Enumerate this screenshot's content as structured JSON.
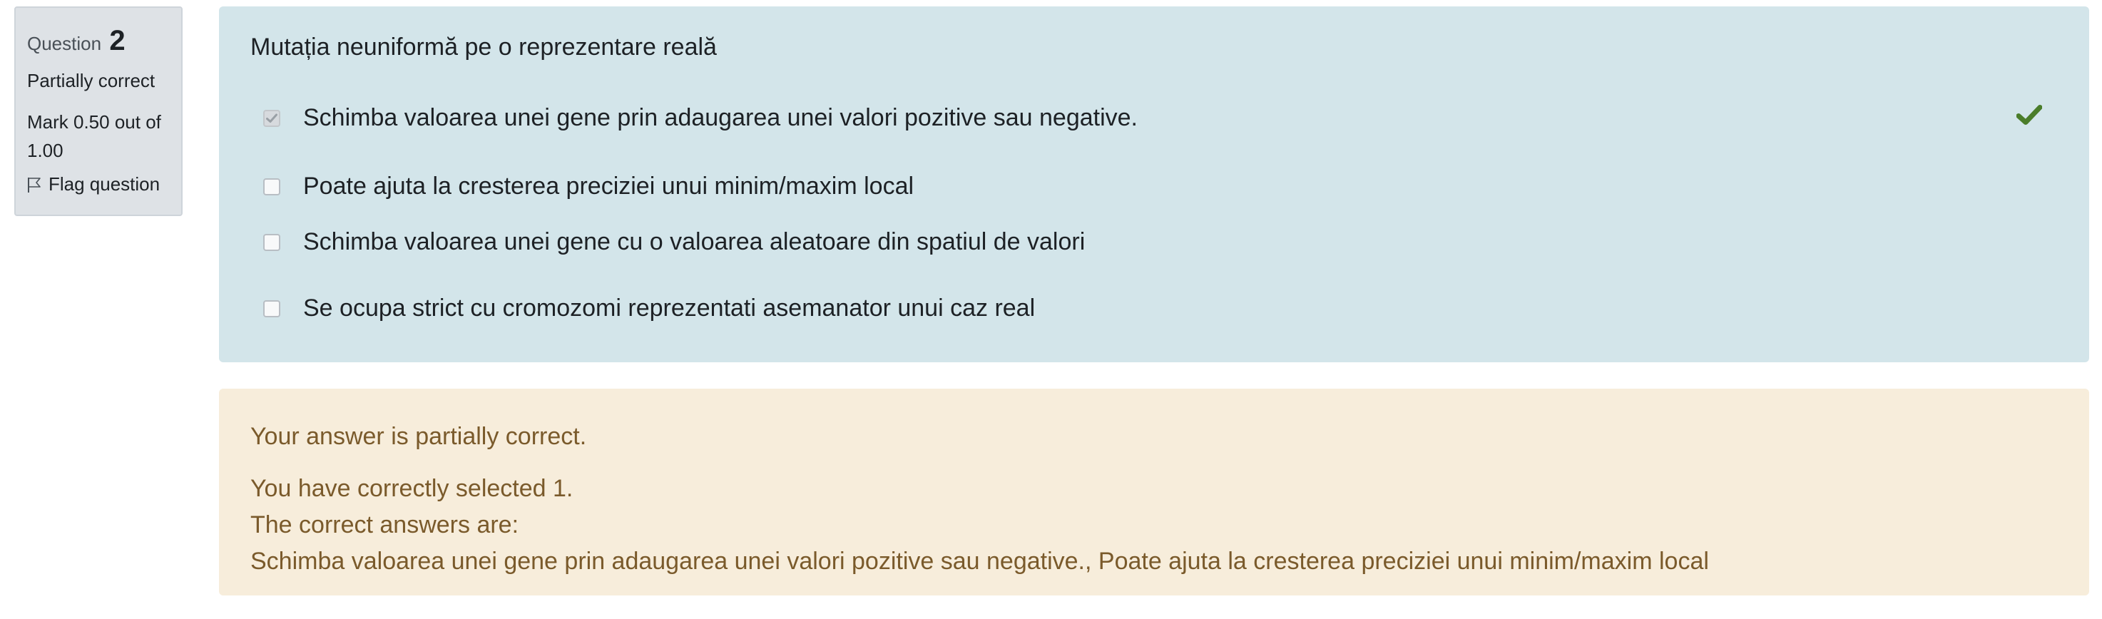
{
  "info": {
    "question_label": "Question",
    "question_number": "2",
    "state": "Partially correct",
    "grade": "Mark 0.50 out of 1.00",
    "flag_label": "Flag question",
    "flag_icon": "flag-outline-icon"
  },
  "question": {
    "prompt": "Mutația neuniformă pe o reprezentare reală",
    "answers": [
      {
        "label": "Schimba valoarea unei gene prin adaugarea unei valori pozitive sau negative.",
        "checked": true,
        "mark": "correct"
      },
      {
        "label": "Poate ajuta la cresterea preciziei unui minim/maxim local",
        "checked": false
      },
      {
        "label": "Schimba valoarea unei gene cu o valoarea aleatoare din spatiul de valori",
        "checked": false
      },
      {
        "label": "Se ocupa strict cu cromozomi reprezentati asemanator unui caz real",
        "checked": false
      }
    ]
  },
  "feedback": {
    "summary": "Your answer is partially correct.",
    "selected_count": "You have correctly selected 1.",
    "correct_heading": "The correct answers are:",
    "correct_list": "Schimba valoarea unei gene prin adaugarea unei valori pozitive sau negative., Poate ajuta la cresterea preciziei unui minim/maxim local"
  },
  "colors": {
    "question_bg": "#d3e5ea",
    "feedback_bg": "#f7eddb",
    "feedback_text": "#7a5a2b",
    "correct_tick": "#4a7d2a",
    "info_bg": "#dee2e6"
  }
}
